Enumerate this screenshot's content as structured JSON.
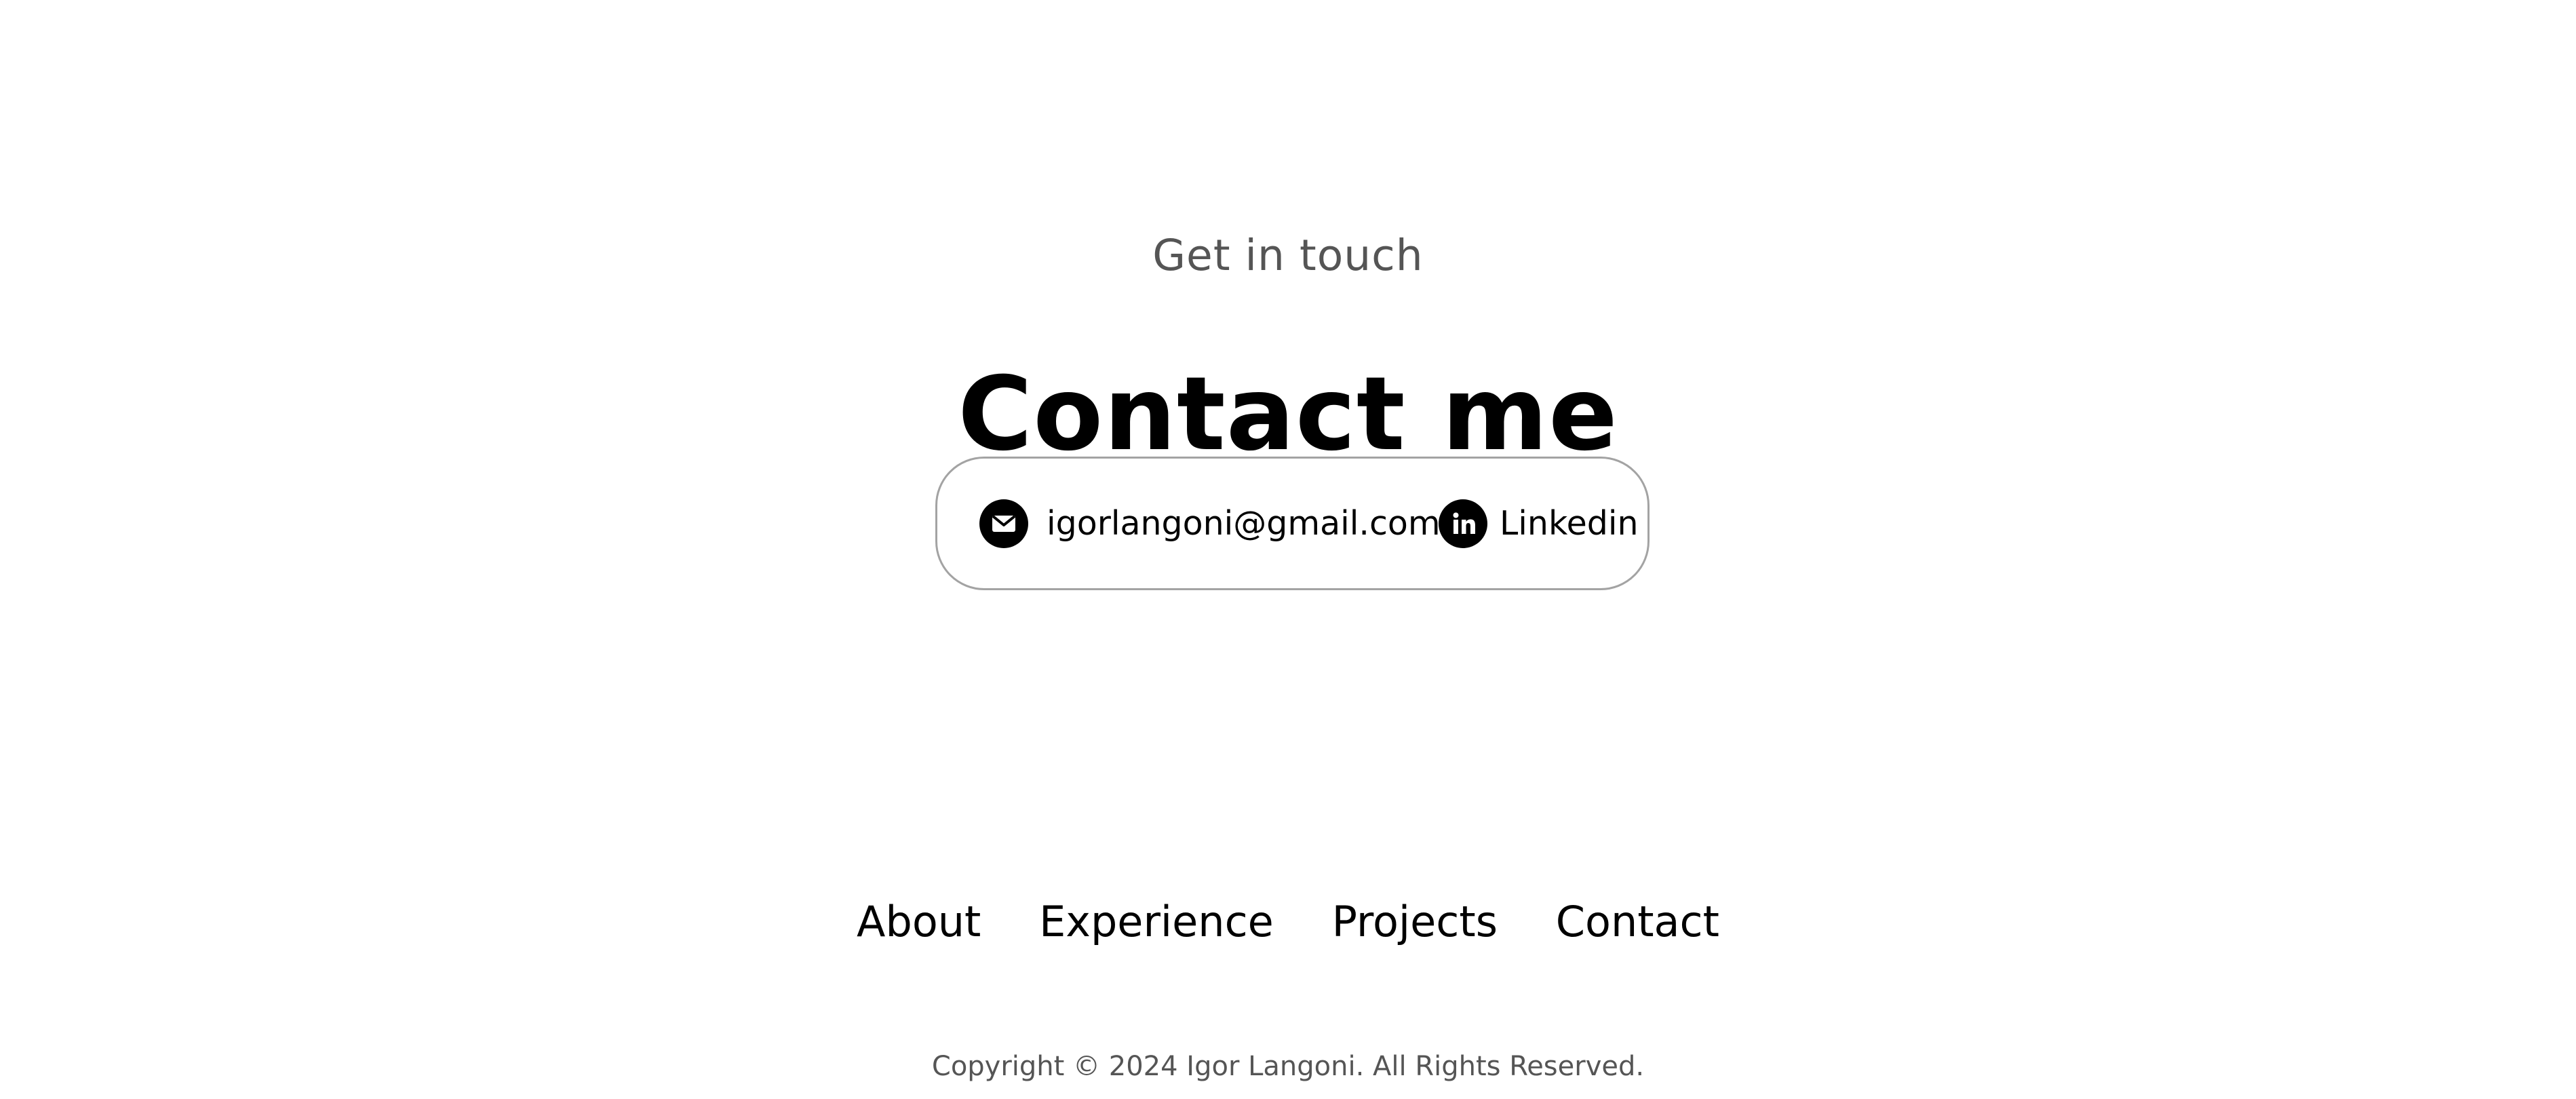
{
  "contact_section": {
    "eyebrow": "Get in touch",
    "title": "Contact me",
    "email": {
      "icon": "mail-icon",
      "text": "igorlangoni@gmail.com"
    },
    "linkedin": {
      "icon": "linkedin-icon",
      "text": "Linkedin"
    }
  },
  "footer": {
    "nav": [
      {
        "label": "About"
      },
      {
        "label": "Experience"
      },
      {
        "label": "Projects"
      },
      {
        "label": "Contact"
      }
    ],
    "copyright": "Copyright © 2024 Igor Langoni. All Rights Reserved."
  },
  "colors": {
    "background": "#ffffff",
    "text_primary": "#000000",
    "text_secondary": "#555555",
    "card_border": "#a3a3a3"
  }
}
